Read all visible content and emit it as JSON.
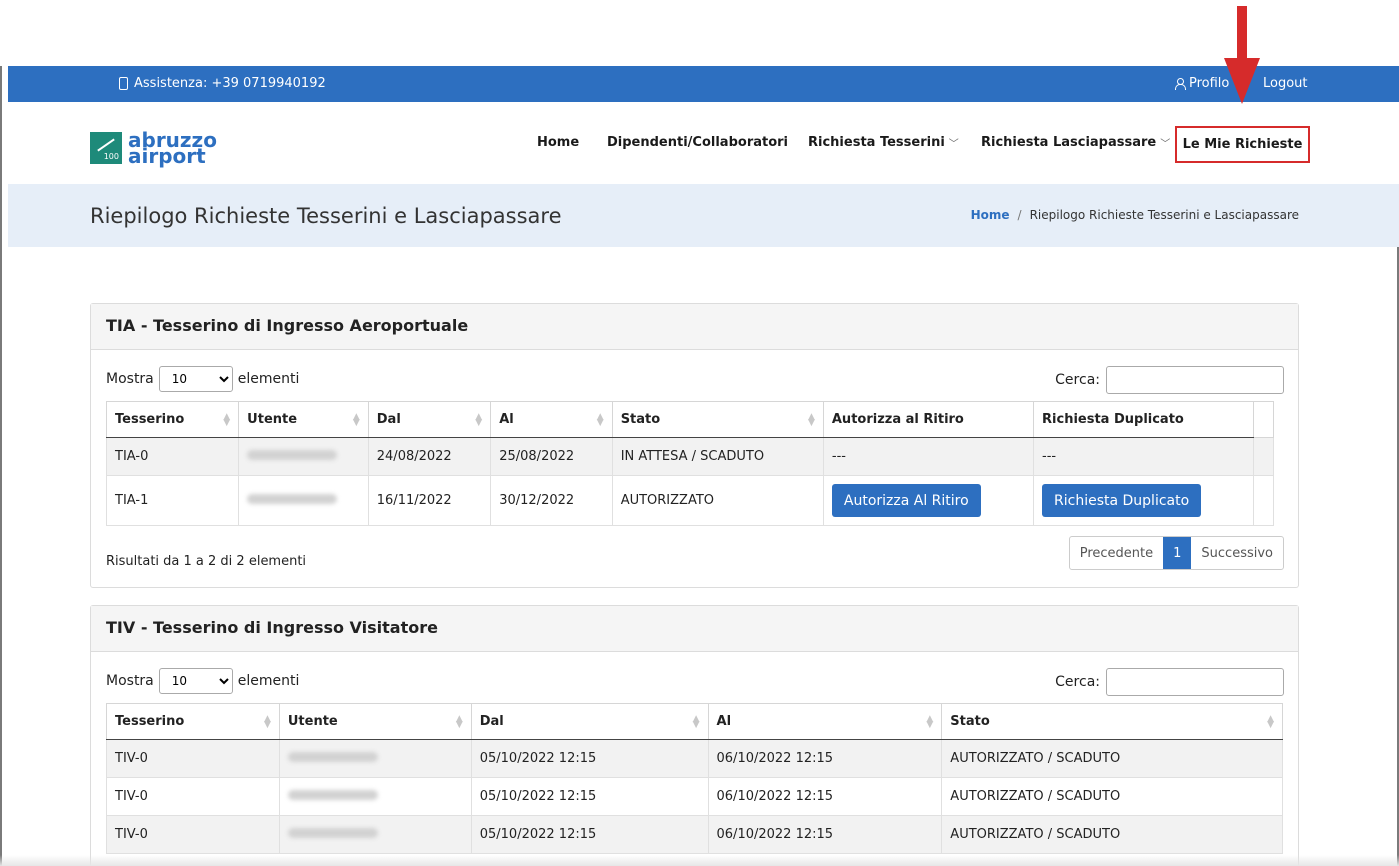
{
  "topbar": {
    "assistenza": "Assistenza: +39 0719940192",
    "profilo": "Profilo",
    "logout": "Logout"
  },
  "brand": {
    "line1": "abruzzo",
    "line2": "airport",
    "badge": "100"
  },
  "nav": {
    "home": "Home",
    "dipendenti": "Dipendenti/Collaboratori",
    "tesserini": "Richiesta Tesserini",
    "lasciapassare": "Richiesta Lasciapassare",
    "mie_richieste": "Le Mie Richieste"
  },
  "page": {
    "title": "Riepilogo Richieste Tesserini e Lasciapassare",
    "breadcrumb_home": "Home",
    "breadcrumb_sep": "/",
    "breadcrumb_current": "Riepilogo Richieste Tesserini e Lasciapassare"
  },
  "tia": {
    "title": "TIA - Tesserino di Ingresso Aeroportuale",
    "show_label": "Mostra",
    "show_value": "10",
    "show_suffix": "elementi",
    "search_label": "Cerca:",
    "headers": [
      "Tesserino",
      "Utente",
      "Dal",
      "Al",
      "Stato",
      "Autorizza al Ritiro",
      "Richiesta Duplicato"
    ],
    "rows": [
      {
        "tesserino": "TIA-0",
        "dal": "24/08/2022",
        "al": "25/08/2022",
        "stato": "IN ATTESA / SCADUTO",
        "autorizza": "---",
        "duplicato": "---"
      },
      {
        "tesserino": "TIA-1",
        "dal": "16/11/2022",
        "al": "30/12/2022",
        "stato": "AUTORIZZATO",
        "autorizza_btn": "Autorizza Al Ritiro",
        "duplicato_btn": "Richiesta Duplicato"
      }
    ],
    "info": "Risultati da 1 a 2 di 2 elementi",
    "prev": "Precedente",
    "page": "1",
    "next": "Successivo"
  },
  "tiv": {
    "title": "TIV - Tesserino di Ingresso Visitatore",
    "show_label": "Mostra",
    "show_value": "10",
    "show_suffix": "elementi",
    "search_label": "Cerca:",
    "headers": [
      "Tesserino",
      "Utente",
      "Dal",
      "Al",
      "Stato"
    ],
    "rows": [
      {
        "tesserino": "TIV-0",
        "dal": "05/10/2022 12:15",
        "al": "06/10/2022 12:15",
        "stato": "AUTORIZZATO / SCADUTO"
      },
      {
        "tesserino": "TIV-0",
        "dal": "05/10/2022 12:15",
        "al": "06/10/2022 12:15",
        "stato": "AUTORIZZATO / SCADUTO"
      },
      {
        "tesserino": "TIV-0",
        "dal": "05/10/2022 12:15",
        "al": "06/10/2022 12:15",
        "stato": "AUTORIZZATO / SCADUTO"
      }
    ]
  },
  "colors": {
    "primary": "#2d6fc0",
    "highlight": "#d62b2b",
    "band": "#e6eef8"
  }
}
